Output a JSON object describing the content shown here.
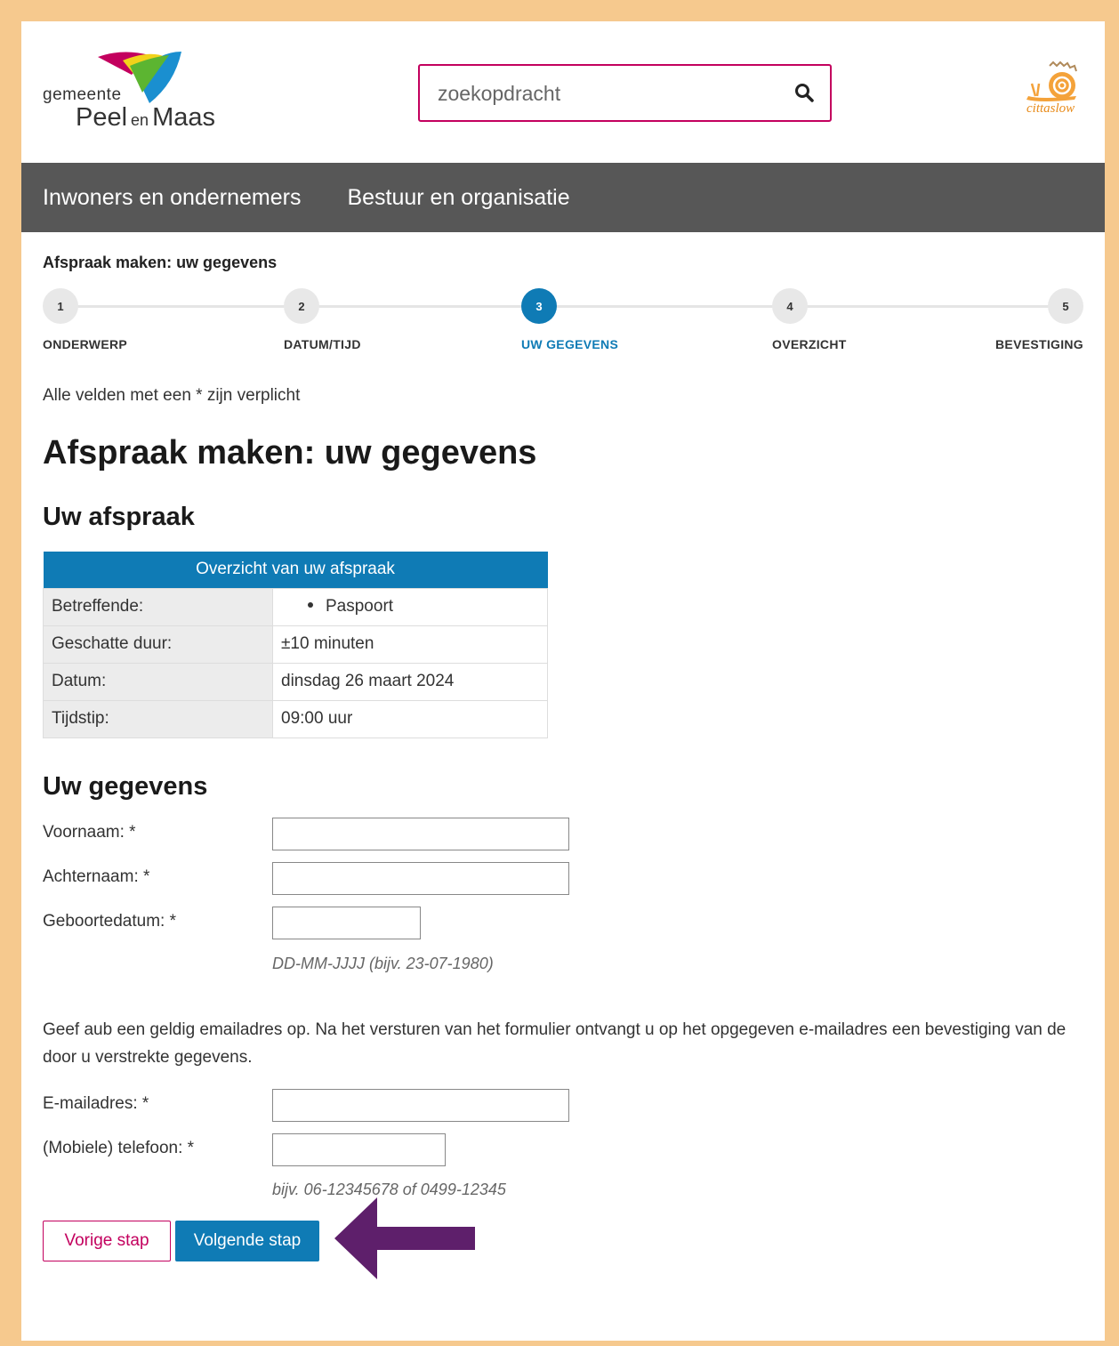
{
  "logo": {
    "top": "gemeente",
    "brand_a": "Peel",
    "brand_en": "en",
    "brand_b": "Maas"
  },
  "search": {
    "placeholder": "zoekopdracht"
  },
  "partner_logo": {
    "label": "cittaslow"
  },
  "nav": {
    "items": [
      {
        "label": "Inwoners en ondernemers"
      },
      {
        "label": "Bestuur en organisatie"
      }
    ]
  },
  "breadcrumb_title": "Afspraak maken: uw gegevens",
  "stepper": {
    "active_step": 3,
    "steps": [
      {
        "num": "1",
        "label": "ONDERWERP"
      },
      {
        "num": "2",
        "label": "DATUM/TIJD"
      },
      {
        "num": "3",
        "label": "UW GEGEVENS"
      },
      {
        "num": "4",
        "label": "OVERZICHT"
      },
      {
        "num": "5",
        "label": "BEVESTIGING"
      }
    ]
  },
  "required_note": "Alle velden met een * zijn verplicht",
  "page_title": "Afspraak maken: uw gegevens",
  "appointment": {
    "heading": "Uw afspraak",
    "table_header": "Overzicht van uw afspraak",
    "rows": [
      {
        "key": "Betreffende:",
        "value": "Paspoort"
      },
      {
        "key": "Geschatte duur:",
        "value": "±10 minuten"
      },
      {
        "key": "Datum:",
        "value": "dinsdag 26 maart 2024"
      },
      {
        "key": "Tijdstip:",
        "value": "09:00 uur"
      }
    ]
  },
  "details": {
    "heading": "Uw gegevens",
    "first_name": {
      "label": "Voornaam: *",
      "value": ""
    },
    "last_name": {
      "label": "Achternaam: *",
      "value": ""
    },
    "birth_date": {
      "label": "Geboortedatum: *",
      "value": "",
      "hint": "DD-MM-JJJJ (bijv. 23-07-1980)"
    },
    "email_note": "Geef aub een geldig emailadres op. Na het versturen van het formulier ontvangt u op het opgegeven e-mailadres een bevestiging van de door u verstrekte gegevens.",
    "email": {
      "label": "E-mailadres: *",
      "value": ""
    },
    "phone": {
      "label": "(Mobiele) telefoon: *",
      "value": "",
      "hint": "bijv. 06-12345678 of 0499-12345"
    }
  },
  "buttons": {
    "prev": "Vorige stap",
    "next": "Volgende stap"
  },
  "colors": {
    "frame": "#f6c98e",
    "nav": "#575757",
    "primary": "#0f7bb5",
    "accent": "#c3005e",
    "arrow": "#5e1f6b"
  }
}
